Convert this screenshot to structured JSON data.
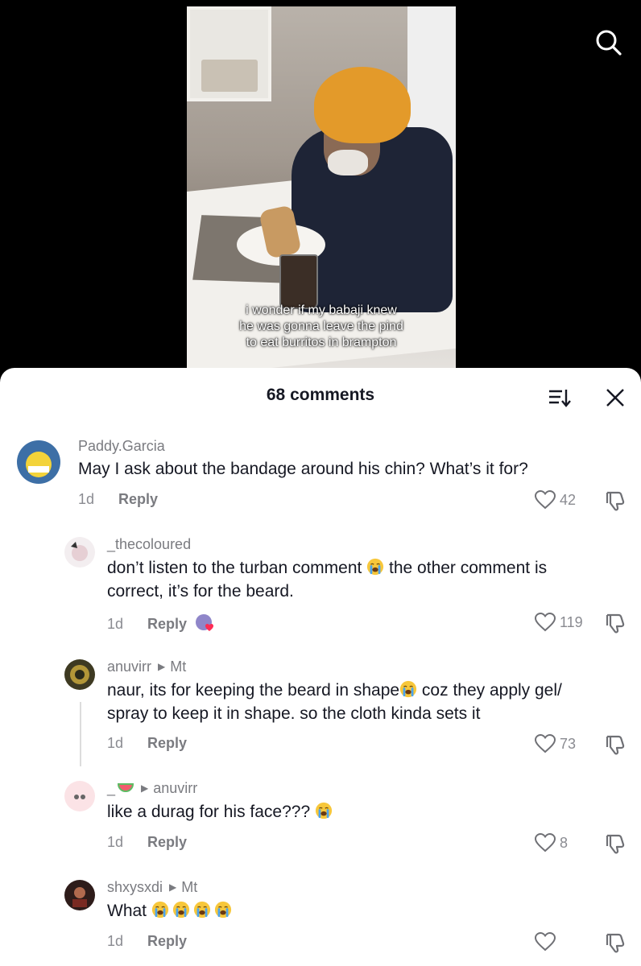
{
  "video": {
    "caption_lines": [
      "i wonder if my babaji knew",
      "he was gonna leave the pind",
      "to eat burritos in brampton"
    ]
  },
  "icons": {
    "search": "search-icon",
    "sort": "sort-icon",
    "close": "close-icon",
    "like": "heart-icon",
    "dislike": "thumbs-down-icon",
    "emoji": "loudly-crying-face-emoji"
  },
  "colors": {
    "text": "#161823",
    "muted": "#8a8b91",
    "sheet_bg": "#ffffff"
  },
  "sheet": {
    "title": "68 comments"
  },
  "comments": [
    {
      "username": "Paddy.Garcia",
      "reply_to": "",
      "text": "May I ask about the bandage around his chin? What’s it for?",
      "age": "1d",
      "reply_label": "Reply",
      "likes": "42"
    },
    {
      "username": "_thecoloured",
      "reply_to": "",
      "text_line1_a": "don’t listen to the turban comment ",
      "text_line1_b": " the other comment is",
      "text_line2": "correct, it’s for the beard.",
      "age": "1d",
      "reply_label": "Reply",
      "likes": "119"
    },
    {
      "username": "anuvirr",
      "reply_to": "Mt",
      "text_line1_a": "naur, its for keeping the beard in shape",
      "text_line1_b": " coz they apply gel/",
      "text_line2": "spray to keep it in shape. so the cloth kinda sets it",
      "age": "1d",
      "reply_label": "Reply",
      "likes": "73"
    },
    {
      "username": "_",
      "reply_to": "anuvirr",
      "text": "like a durag for his face??? ",
      "age": "1d",
      "reply_label": "Reply",
      "likes": "8"
    },
    {
      "username": "shxysxdi",
      "reply_to": "Mt",
      "text": "What ",
      "age": "1d",
      "reply_label": "Reply",
      "likes": ""
    }
  ]
}
